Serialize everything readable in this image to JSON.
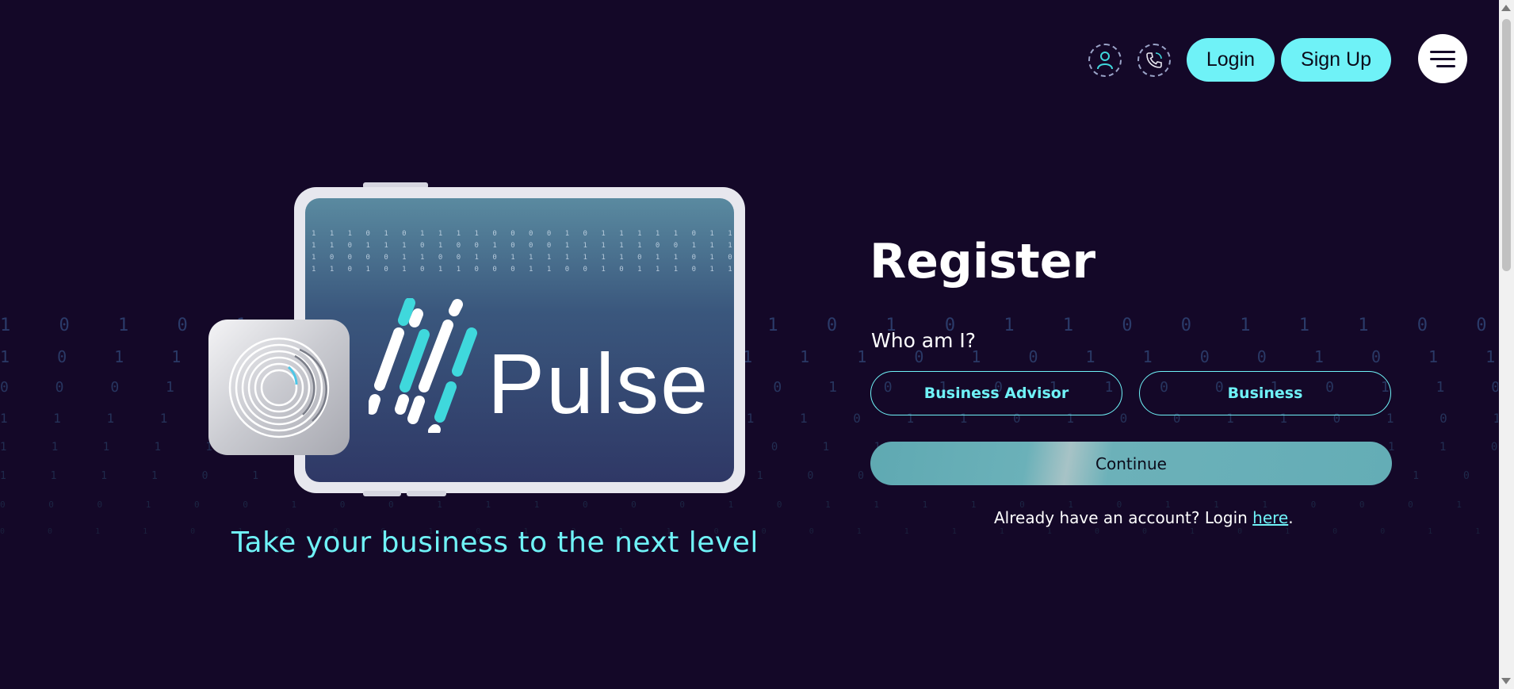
{
  "header": {
    "user_icon": "user-icon",
    "phone_icon": "phone-icon",
    "login_label": "Login",
    "signup_label": "Sign Up",
    "menu_icon": "hamburger-menu-icon"
  },
  "hero": {
    "logo_text": "Pulse",
    "tagline": "Take your business to the next level"
  },
  "form": {
    "title": "Register",
    "question": "Who am I?",
    "roles": [
      "Business Advisor",
      "Business"
    ],
    "continue_label": "Continue",
    "account_prompt": "Already have an account? Login ",
    "account_link": "here",
    "account_suffix": "."
  },
  "colors": {
    "background": "#140828",
    "accent": "#6ff2f7",
    "continue_bg": "#64adb6"
  }
}
